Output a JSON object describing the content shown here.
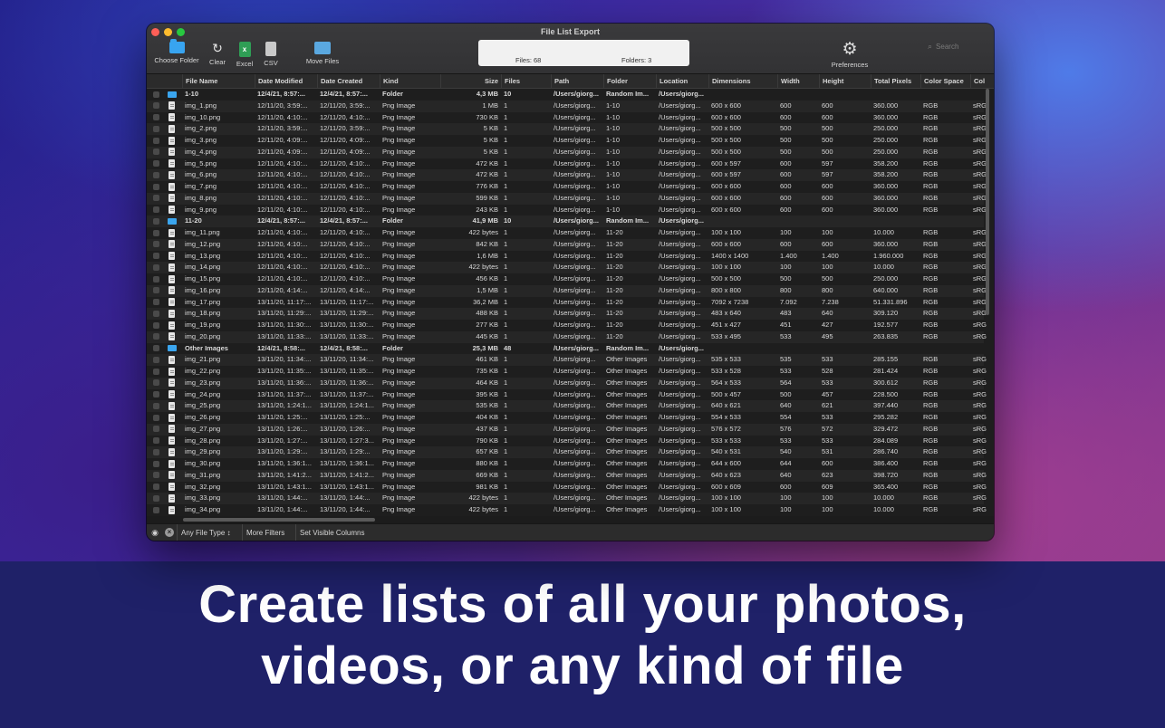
{
  "headline": {
    "line1": "Create lists of all your photos,",
    "line2": "videos, or any kind of file"
  },
  "window": {
    "title": "File List Export"
  },
  "toolbar": {
    "choose_folder": "Choose Folder",
    "clear": "Clear",
    "excel": "Excel",
    "csv": "CSV",
    "move_files": "Move Files",
    "preferences": "Preferences",
    "search_placeholder": "Search"
  },
  "summary": {
    "files": "Files: 68",
    "folders": "Folders: 3"
  },
  "columns": [
    "File Name",
    "Date Modified",
    "Date Created",
    "Kind",
    "Size",
    "Files",
    "Path",
    "Folder",
    "Location",
    "Dimensions",
    "Width",
    "Height",
    "Total Pixels",
    "Color Space",
    "Col"
  ],
  "rows": [
    {
      "type": "folder",
      "name": "1-10",
      "modified": "12/4/21, 8:57:...",
      "created": "12/4/21, 8:57:...",
      "kind": "Folder",
      "size": "4,3 MB",
      "files": "10",
      "path": "/Users/giorg...",
      "folder": "Random Im...",
      "location": "/Users/giorg...",
      "dims": "",
      "width": "",
      "height": "",
      "pixels": "",
      "cs": "",
      "col": ""
    },
    {
      "type": "file",
      "name": "img_1.png",
      "modified": "12/11/20, 3:59:...",
      "created": "12/11/20, 3:59:...",
      "kind": "Png Image",
      "size": "1 MB",
      "files": "1",
      "path": "/Users/giorg...",
      "folder": "1-10",
      "location": "/Users/giorg...",
      "dims": "600 x 600",
      "width": "600",
      "height": "600",
      "pixels": "360.000",
      "cs": "RGB",
      "col": "sRG"
    },
    {
      "type": "file",
      "name": "img_10.png",
      "modified": "12/11/20, 4:10:...",
      "created": "12/11/20, 4:10:...",
      "kind": "Png Image",
      "size": "730 KB",
      "files": "1",
      "path": "/Users/giorg...",
      "folder": "1-10",
      "location": "/Users/giorg...",
      "dims": "600 x 600",
      "width": "600",
      "height": "600",
      "pixels": "360.000",
      "cs": "RGB",
      "col": "sRG"
    },
    {
      "type": "file",
      "name": "img_2.png",
      "modified": "12/11/20, 3:59:...",
      "created": "12/11/20, 3:59:...",
      "kind": "Png Image",
      "size": "5 KB",
      "files": "1",
      "path": "/Users/giorg...",
      "folder": "1-10",
      "location": "/Users/giorg...",
      "dims": "500 x 500",
      "width": "500",
      "height": "500",
      "pixels": "250.000",
      "cs": "RGB",
      "col": "sRG"
    },
    {
      "type": "file",
      "name": "img_3.png",
      "modified": "12/11/20, 4:09:...",
      "created": "12/11/20, 4:09:...",
      "kind": "Png Image",
      "size": "5 KB",
      "files": "1",
      "path": "/Users/giorg...",
      "folder": "1-10",
      "location": "/Users/giorg...",
      "dims": "500 x 500",
      "width": "500",
      "height": "500",
      "pixels": "250.000",
      "cs": "RGB",
      "col": "sRG"
    },
    {
      "type": "file",
      "name": "img_4.png",
      "modified": "12/11/20, 4:09:...",
      "created": "12/11/20, 4:09:...",
      "kind": "Png Image",
      "size": "5 KB",
      "files": "1",
      "path": "/Users/giorg...",
      "folder": "1-10",
      "location": "/Users/giorg...",
      "dims": "500 x 500",
      "width": "500",
      "height": "500",
      "pixels": "250.000",
      "cs": "RGB",
      "col": "sRG"
    },
    {
      "type": "file",
      "name": "img_5.png",
      "modified": "12/11/20, 4:10:...",
      "created": "12/11/20, 4:10:...",
      "kind": "Png Image",
      "size": "472 KB",
      "files": "1",
      "path": "/Users/giorg...",
      "folder": "1-10",
      "location": "/Users/giorg...",
      "dims": "600 x 597",
      "width": "600",
      "height": "597",
      "pixels": "358.200",
      "cs": "RGB",
      "col": "sRG"
    },
    {
      "type": "file",
      "name": "img_6.png",
      "modified": "12/11/20, 4:10:...",
      "created": "12/11/20, 4:10:...",
      "kind": "Png Image",
      "size": "472 KB",
      "files": "1",
      "path": "/Users/giorg...",
      "folder": "1-10",
      "location": "/Users/giorg...",
      "dims": "600 x 597",
      "width": "600",
      "height": "597",
      "pixels": "358.200",
      "cs": "RGB",
      "col": "sRG"
    },
    {
      "type": "file",
      "name": "img_7.png",
      "modified": "12/11/20, 4:10:...",
      "created": "12/11/20, 4:10:...",
      "kind": "Png Image",
      "size": "776 KB",
      "files": "1",
      "path": "/Users/giorg...",
      "folder": "1-10",
      "location": "/Users/giorg...",
      "dims": "600 x 600",
      "width": "600",
      "height": "600",
      "pixels": "360.000",
      "cs": "RGB",
      "col": "sRG"
    },
    {
      "type": "file",
      "name": "img_8.png",
      "modified": "12/11/20, 4:10:...",
      "created": "12/11/20, 4:10:...",
      "kind": "Png Image",
      "size": "599 KB",
      "files": "1",
      "path": "/Users/giorg...",
      "folder": "1-10",
      "location": "/Users/giorg...",
      "dims": "600 x 600",
      "width": "600",
      "height": "600",
      "pixels": "360.000",
      "cs": "RGB",
      "col": "sRG"
    },
    {
      "type": "file",
      "name": "img_9.png",
      "modified": "12/11/20, 4:10:...",
      "created": "12/11/20, 4:10:...",
      "kind": "Png Image",
      "size": "243 KB",
      "files": "1",
      "path": "/Users/giorg...",
      "folder": "1-10",
      "location": "/Users/giorg...",
      "dims": "600 x 600",
      "width": "600",
      "height": "600",
      "pixels": "360.000",
      "cs": "RGB",
      "col": "sRG"
    },
    {
      "type": "folder",
      "name": "11-20",
      "modified": "12/4/21, 8:57:...",
      "created": "12/4/21, 8:57:...",
      "kind": "Folder",
      "size": "41,9 MB",
      "files": "10",
      "path": "/Users/giorg...",
      "folder": "Random Im...",
      "location": "/Users/giorg...",
      "dims": "",
      "width": "",
      "height": "",
      "pixels": "",
      "cs": "",
      "col": ""
    },
    {
      "type": "file",
      "name": "img_11.png",
      "modified": "12/11/20, 4:10:...",
      "created": "12/11/20, 4:10:...",
      "kind": "Png Image",
      "size": "422 bytes",
      "files": "1",
      "path": "/Users/giorg...",
      "folder": "11-20",
      "location": "/Users/giorg...",
      "dims": "100 x 100",
      "width": "100",
      "height": "100",
      "pixels": "10.000",
      "cs": "RGB",
      "col": "sRG"
    },
    {
      "type": "file",
      "name": "img_12.png",
      "modified": "12/11/20, 4:10:...",
      "created": "12/11/20, 4:10:...",
      "kind": "Png Image",
      "size": "842 KB",
      "files": "1",
      "path": "/Users/giorg...",
      "folder": "11-20",
      "location": "/Users/giorg...",
      "dims": "600 x 600",
      "width": "600",
      "height": "600",
      "pixels": "360.000",
      "cs": "RGB",
      "col": "sRG"
    },
    {
      "type": "file",
      "name": "img_13.png",
      "modified": "12/11/20, 4:10:...",
      "created": "12/11/20, 4:10:...",
      "kind": "Png Image",
      "size": "1,6 MB",
      "files": "1",
      "path": "/Users/giorg...",
      "folder": "11-20",
      "location": "/Users/giorg...",
      "dims": "1400 x 1400",
      "width": "1.400",
      "height": "1.400",
      "pixels": "1.960.000",
      "cs": "RGB",
      "col": "sRG"
    },
    {
      "type": "file",
      "name": "img_14.png",
      "modified": "12/11/20, 4:10:...",
      "created": "12/11/20, 4:10:...",
      "kind": "Png Image",
      "size": "422 bytes",
      "files": "1",
      "path": "/Users/giorg...",
      "folder": "11-20",
      "location": "/Users/giorg...",
      "dims": "100 x 100",
      "width": "100",
      "height": "100",
      "pixels": "10.000",
      "cs": "RGB",
      "col": "sRG"
    },
    {
      "type": "file",
      "name": "img_15.png",
      "modified": "12/11/20, 4:10:...",
      "created": "12/11/20, 4:10:...",
      "kind": "Png Image",
      "size": "456 KB",
      "files": "1",
      "path": "/Users/giorg...",
      "folder": "11-20",
      "location": "/Users/giorg...",
      "dims": "500 x 500",
      "width": "500",
      "height": "500",
      "pixels": "250.000",
      "cs": "RGB",
      "col": "sRG"
    },
    {
      "type": "file",
      "name": "img_16.png",
      "modified": "12/11/20, 4:14:...",
      "created": "12/11/20, 4:14:...",
      "kind": "Png Image",
      "size": "1,5 MB",
      "files": "1",
      "path": "/Users/giorg...",
      "folder": "11-20",
      "location": "/Users/giorg...",
      "dims": "800 x 800",
      "width": "800",
      "height": "800",
      "pixels": "640.000",
      "cs": "RGB",
      "col": "sRG"
    },
    {
      "type": "file",
      "name": "img_17.png",
      "modified": "13/11/20, 11:17:...",
      "created": "13/11/20, 11:17:...",
      "kind": "Png Image",
      "size": "36,2 MB",
      "files": "1",
      "path": "/Users/giorg...",
      "folder": "11-20",
      "location": "/Users/giorg...",
      "dims": "7092 x 7238",
      "width": "7.092",
      "height": "7.238",
      "pixels": "51.331.896",
      "cs": "RGB",
      "col": "sRG"
    },
    {
      "type": "file",
      "name": "img_18.png",
      "modified": "13/11/20, 11:29:...",
      "created": "13/11/20, 11:29:...",
      "kind": "Png Image",
      "size": "488 KB",
      "files": "1",
      "path": "/Users/giorg...",
      "folder": "11-20",
      "location": "/Users/giorg...",
      "dims": "483 x 640",
      "width": "483",
      "height": "640",
      "pixels": "309.120",
      "cs": "RGB",
      "col": "sRG"
    },
    {
      "type": "file",
      "name": "img_19.png",
      "modified": "13/11/20, 11:30:...",
      "created": "13/11/20, 11:30:...",
      "kind": "Png Image",
      "size": "277 KB",
      "files": "1",
      "path": "/Users/giorg...",
      "folder": "11-20",
      "location": "/Users/giorg...",
      "dims": "451 x 427",
      "width": "451",
      "height": "427",
      "pixels": "192.577",
      "cs": "RGB",
      "col": "sRG"
    },
    {
      "type": "file",
      "name": "img_20.png",
      "modified": "13/11/20, 11:33:...",
      "created": "13/11/20, 11:33:...",
      "kind": "Png Image",
      "size": "445 KB",
      "files": "1",
      "path": "/Users/giorg...",
      "folder": "11-20",
      "location": "/Users/giorg...",
      "dims": "533 x 495",
      "width": "533",
      "height": "495",
      "pixels": "263.835",
      "cs": "RGB",
      "col": "sRG"
    },
    {
      "type": "folder",
      "name": "Other Images",
      "modified": "12/4/21, 8:58:...",
      "created": "12/4/21, 8:58:...",
      "kind": "Folder",
      "size": "25,3 MB",
      "files": "48",
      "path": "/Users/giorg...",
      "folder": "Random Im...",
      "location": "/Users/giorg...",
      "dims": "",
      "width": "",
      "height": "",
      "pixels": "",
      "cs": "",
      "col": ""
    },
    {
      "type": "file",
      "name": "img_21.png",
      "modified": "13/11/20, 11:34:...",
      "created": "13/11/20, 11:34:...",
      "kind": "Png Image",
      "size": "461 KB",
      "files": "1",
      "path": "/Users/giorg...",
      "folder": "Other Images",
      "location": "/Users/giorg...",
      "dims": "535 x 533",
      "width": "535",
      "height": "533",
      "pixels": "285.155",
      "cs": "RGB",
      "col": "sRG"
    },
    {
      "type": "file",
      "name": "img_22.png",
      "modified": "13/11/20, 11:35:...",
      "created": "13/11/20, 11:35:...",
      "kind": "Png Image",
      "size": "735 KB",
      "files": "1",
      "path": "/Users/giorg...",
      "folder": "Other Images",
      "location": "/Users/giorg...",
      "dims": "533 x 528",
      "width": "533",
      "height": "528",
      "pixels": "281.424",
      "cs": "RGB",
      "col": "sRG"
    },
    {
      "type": "file",
      "name": "img_23.png",
      "modified": "13/11/20, 11:36:...",
      "created": "13/11/20, 11:36:...",
      "kind": "Png Image",
      "size": "464 KB",
      "files": "1",
      "path": "/Users/giorg...",
      "folder": "Other Images",
      "location": "/Users/giorg...",
      "dims": "564 x 533",
      "width": "564",
      "height": "533",
      "pixels": "300.612",
      "cs": "RGB",
      "col": "sRG"
    },
    {
      "type": "file",
      "name": "img_24.png",
      "modified": "13/11/20, 11:37:...",
      "created": "13/11/20, 11:37:...",
      "kind": "Png Image",
      "size": "395 KB",
      "files": "1",
      "path": "/Users/giorg...",
      "folder": "Other Images",
      "location": "/Users/giorg...",
      "dims": "500 x 457",
      "width": "500",
      "height": "457",
      "pixels": "228.500",
      "cs": "RGB",
      "col": "sRG"
    },
    {
      "type": "file",
      "name": "img_25.png",
      "modified": "13/11/20, 1:24:1...",
      "created": "13/11/20, 1:24:1...",
      "kind": "Png Image",
      "size": "535 KB",
      "files": "1",
      "path": "/Users/giorg...",
      "folder": "Other Images",
      "location": "/Users/giorg...",
      "dims": "640 x 621",
      "width": "640",
      "height": "621",
      "pixels": "397.440",
      "cs": "RGB",
      "col": "sRG"
    },
    {
      "type": "file",
      "name": "img_26.png",
      "modified": "13/11/20, 1:25:...",
      "created": "13/11/20, 1:25:...",
      "kind": "Png Image",
      "size": "404 KB",
      "files": "1",
      "path": "/Users/giorg...",
      "folder": "Other Images",
      "location": "/Users/giorg...",
      "dims": "554 x 533",
      "width": "554",
      "height": "533",
      "pixels": "295.282",
      "cs": "RGB",
      "col": "sRG"
    },
    {
      "type": "file",
      "name": "img_27.png",
      "modified": "13/11/20, 1:26:...",
      "created": "13/11/20, 1:26:...",
      "kind": "Png Image",
      "size": "437 KB",
      "files": "1",
      "path": "/Users/giorg...",
      "folder": "Other Images",
      "location": "/Users/giorg...",
      "dims": "576 x 572",
      "width": "576",
      "height": "572",
      "pixels": "329.472",
      "cs": "RGB",
      "col": "sRG"
    },
    {
      "type": "file",
      "name": "img_28.png",
      "modified": "13/11/20, 1:27:...",
      "created": "13/11/20, 1:27:3...",
      "kind": "Png Image",
      "size": "790 KB",
      "files": "1",
      "path": "/Users/giorg...",
      "folder": "Other Images",
      "location": "/Users/giorg...",
      "dims": "533 x 533",
      "width": "533",
      "height": "533",
      "pixels": "284.089",
      "cs": "RGB",
      "col": "sRG"
    },
    {
      "type": "file",
      "name": "img_29.png",
      "modified": "13/11/20, 1:29:...",
      "created": "13/11/20, 1:29:...",
      "kind": "Png Image",
      "size": "657 KB",
      "files": "1",
      "path": "/Users/giorg...",
      "folder": "Other Images",
      "location": "/Users/giorg...",
      "dims": "540 x 531",
      "width": "540",
      "height": "531",
      "pixels": "286.740",
      "cs": "RGB",
      "col": "sRG"
    },
    {
      "type": "file",
      "name": "img_30.png",
      "modified": "13/11/20, 1:36:1...",
      "created": "13/11/20, 1:36:1...",
      "kind": "Png Image",
      "size": "880 KB",
      "files": "1",
      "path": "/Users/giorg...",
      "folder": "Other Images",
      "location": "/Users/giorg...",
      "dims": "644 x 600",
      "width": "644",
      "height": "600",
      "pixels": "386.400",
      "cs": "RGB",
      "col": "sRG"
    },
    {
      "type": "file",
      "name": "img_31.png",
      "modified": "13/11/20, 1:41:2...",
      "created": "13/11/20, 1:41:2...",
      "kind": "Png Image",
      "size": "669 KB",
      "files": "1",
      "path": "/Users/giorg...",
      "folder": "Other Images",
      "location": "/Users/giorg...",
      "dims": "640 x 623",
      "width": "640",
      "height": "623",
      "pixels": "398.720",
      "cs": "RGB",
      "col": "sRG"
    },
    {
      "type": "file",
      "name": "img_32.png",
      "modified": "13/11/20, 1:43:1...",
      "created": "13/11/20, 1:43:1...",
      "kind": "Png Image",
      "size": "981 KB",
      "files": "1",
      "path": "/Users/giorg...",
      "folder": "Other Images",
      "location": "/Users/giorg...",
      "dims": "600 x 609",
      "width": "600",
      "height": "609",
      "pixels": "365.400",
      "cs": "RGB",
      "col": "sRG"
    },
    {
      "type": "file",
      "name": "img_33.png",
      "modified": "13/11/20, 1:44:...",
      "created": "13/11/20, 1:44:...",
      "kind": "Png Image",
      "size": "422 bytes",
      "files": "1",
      "path": "/Users/giorg...",
      "folder": "Other Images",
      "location": "/Users/giorg...",
      "dims": "100 x 100",
      "width": "100",
      "height": "100",
      "pixels": "10.000",
      "cs": "RGB",
      "col": "sRG"
    },
    {
      "type": "file",
      "name": "img_34.png",
      "modified": "13/11/20, 1:44:...",
      "created": "13/11/20, 1:44:...",
      "kind": "Png Image",
      "size": "422 bytes",
      "files": "1",
      "path": "/Users/giorg...",
      "folder": "Other Images",
      "location": "/Users/giorg...",
      "dims": "100 x 100",
      "width": "100",
      "height": "100",
      "pixels": "10.000",
      "cs": "RGB",
      "col": "sRG"
    }
  ],
  "footer": {
    "file_type": "Any File Type",
    "more_filters": "More Filters",
    "set_visible_columns": "Set Visible Columns"
  },
  "colors": {
    "window_bg": "#1e1e1e",
    "folder_icon": "#3aa5ee",
    "accent_excel": "#2f9e55"
  }
}
